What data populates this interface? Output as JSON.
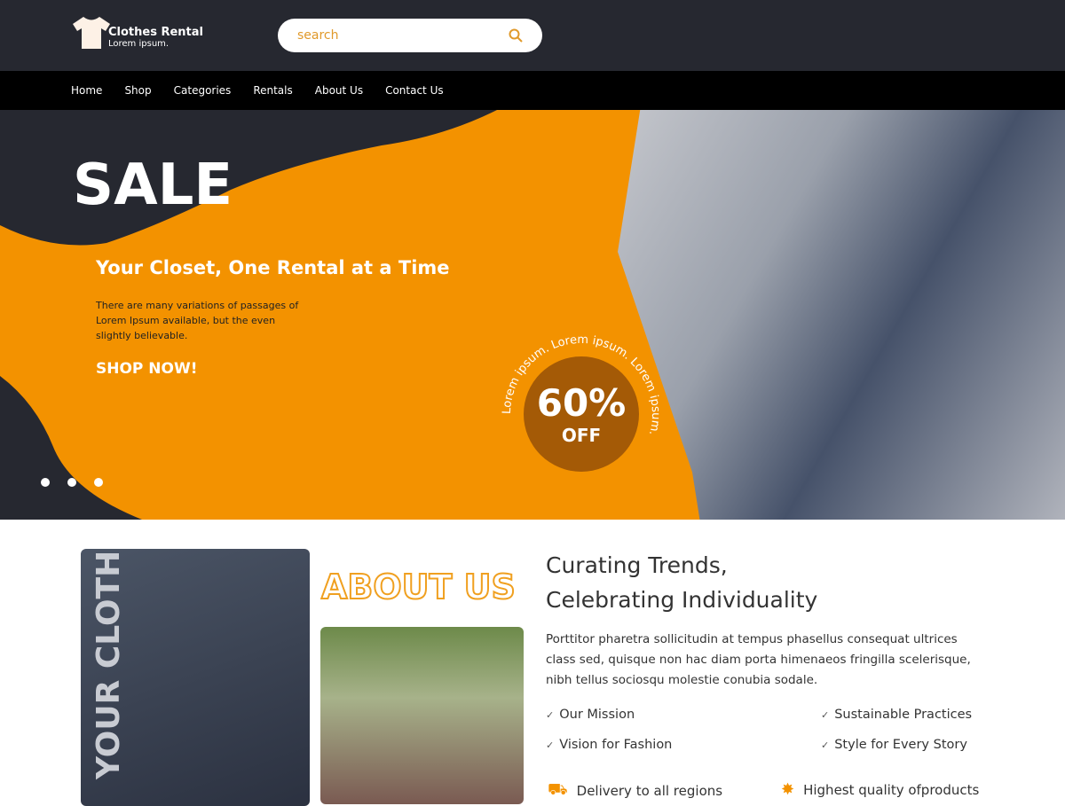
{
  "header": {
    "brand": "Clothes Rental",
    "tagline": "Lorem ipsum.",
    "search_placeholder": "search"
  },
  "nav": [
    "Home",
    "Shop",
    "Categories",
    "Rentals",
    "About Us",
    "Contact Us"
  ],
  "hero": {
    "title": "SALE",
    "tagline": "Your Closet, One Rental at a Time",
    "description": "There are many variations of passages of Lorem Ipsum available, but the even slightly believable.",
    "cta": "SHOP NOW!",
    "badge_percent": "60%",
    "badge_off": "OFF",
    "badge_ring": "Lorem ipsum. Lorem ipsum. Lorem ipsum.",
    "slides": 3
  },
  "about": {
    "vertical_text": "YOUR CLOTH",
    "title": "ABOUT US",
    "heading_line1": "Curating Trends,",
    "heading_line2": "Celebrating Individuality",
    "paragraph": "Porttitor pharetra sollicitudin at tempus phasellus consequat ultrices class sed, quisque non hac diam porta himenaeos fringilla scelerisque, nibh tellus sociosqu molestie conubia sodale.",
    "points": [
      "Our Mission",
      "Sustainable Practices",
      "Vision for Fashion",
      "Style for Every Story"
    ],
    "features": [
      "Delivery to all regions",
      "Highest quality ofproducts"
    ]
  },
  "colors": {
    "accent": "#f39200",
    "dark": "#262830"
  }
}
